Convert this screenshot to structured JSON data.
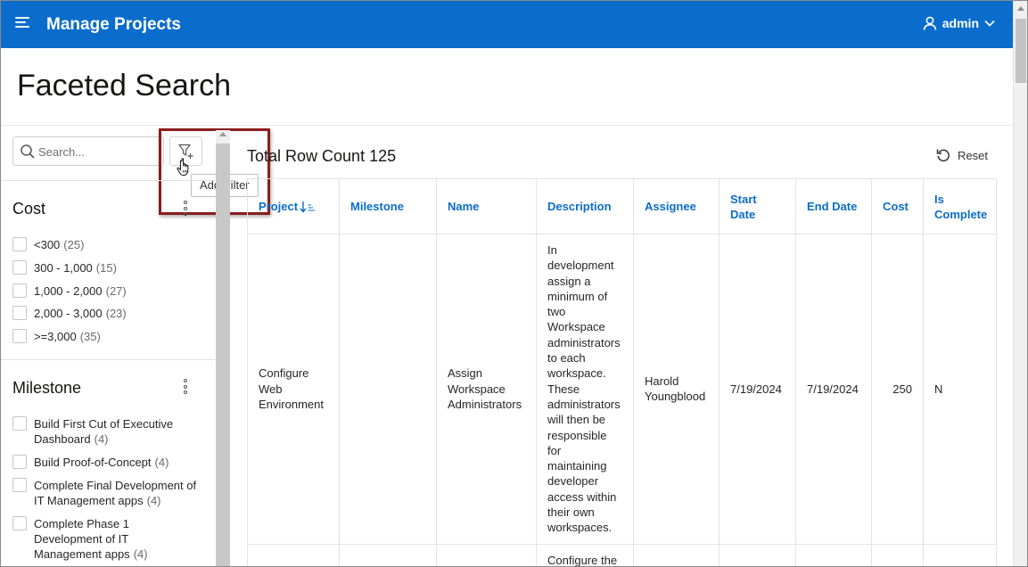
{
  "header": {
    "app_title": "Manage Projects",
    "user": "admin",
    "menu_icon": "hamburger-icon",
    "user_icon": "user-icon",
    "dropdown_icon": "chevron-down-icon"
  },
  "page": {
    "title": "Faceted Search"
  },
  "facets": {
    "search_placeholder": "Search...",
    "add_filter_tooltip": "Add Filter",
    "groups": [
      {
        "label": "Cost",
        "options": [
          {
            "label": "<300",
            "count": "(25)"
          },
          {
            "label": "300 - 1,000",
            "count": "(15)"
          },
          {
            "label": "1,000 - 2,000",
            "count": "(27)"
          },
          {
            "label": "2,000 - 3,000",
            "count": "(23)"
          },
          {
            "label": ">=3,000",
            "count": "(35)"
          }
        ]
      },
      {
        "label": "Milestone",
        "options": [
          {
            "label_lines": [
              "Build First Cut of Executive",
              "Dashboard"
            ],
            "count": "(4)"
          },
          {
            "label_lines": [
              "Build Proof-of-Concept"
            ],
            "count": "(4)"
          },
          {
            "label_lines": [
              "Complete Final Development of",
              "IT Management apps"
            ],
            "count": "(4)"
          },
          {
            "label_lines": [
              "Complete Phase 1",
              "Development of IT",
              "Management apps"
            ],
            "count": "(4)"
          }
        ]
      }
    ]
  },
  "report": {
    "row_count_label": "Total Row Count 125",
    "reset_label": "Reset",
    "columns": [
      {
        "label": "Project"
      },
      {
        "label": "Milestone"
      },
      {
        "label": "Name"
      },
      {
        "label": "Description"
      },
      {
        "label": "Assignee"
      },
      {
        "label_lines": [
          "Start",
          "Date"
        ]
      },
      {
        "label": "End Date"
      },
      {
        "label": "Cost"
      },
      {
        "label_lines": [
          "Is",
          "Complete"
        ]
      }
    ],
    "rows": [
      {
        "project": [
          "Configure",
          "Web",
          "Environment"
        ],
        "milestone": "",
        "name": [
          "Assign",
          "Workspace",
          "Administrators"
        ],
        "description": [
          "In",
          "development",
          "assign a",
          "minimum of",
          "two",
          "Workspace",
          "administrators",
          "to each",
          "workspace.",
          "These",
          "administrators",
          "will then be",
          "responsible",
          "for",
          "maintaining",
          "developer",
          "access within",
          "their own",
          "workspaces."
        ],
        "assignee": [
          "Harold",
          "Youngblood"
        ],
        "start_date": "7/19/2024",
        "end_date": "7/19/2024",
        "cost": "250",
        "is_complete": "N"
      },
      {
        "project": [],
        "milestone": "",
        "name": [],
        "description": [
          "Configure the"
        ],
        "assignee": [],
        "start_date": "",
        "end_date": "",
        "cost": "",
        "is_complete": ""
      }
    ]
  }
}
